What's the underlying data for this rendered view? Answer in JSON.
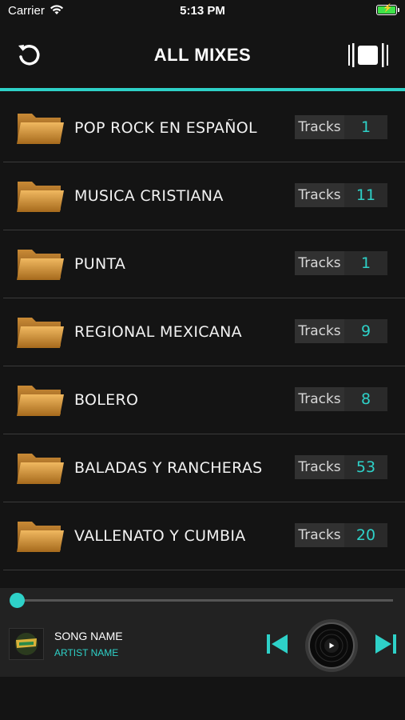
{
  "status_bar": {
    "carrier": "Carrier",
    "time": "5:13 PM"
  },
  "header": {
    "title": "ALL MIXES",
    "accent_color": "#2ed1c8"
  },
  "mixes": [
    {
      "name": "POP ROCK EN ESPAÑOL",
      "tracks_label": "Tracks",
      "count": "1"
    },
    {
      "name": "MUSICA CRISTIANA",
      "tracks_label": "Tracks",
      "count": "11"
    },
    {
      "name": "PUNTA",
      "tracks_label": "Tracks",
      "count": "1"
    },
    {
      "name": "REGIONAL MEXICANA",
      "tracks_label": "Tracks",
      "count": "9"
    },
    {
      "name": "BOLERO",
      "tracks_label": "Tracks",
      "count": "8"
    },
    {
      "name": "BALADAS Y RANCHERAS",
      "tracks_label": "Tracks",
      "count": "53"
    },
    {
      "name": "VALLENATO Y CUMBIA",
      "tracks_label": "Tracks",
      "count": "20"
    }
  ],
  "player": {
    "song_name": "SONG NAME",
    "artist_name": "ARTIST NAME",
    "progress": 0,
    "icons": [
      "previous-icon",
      "play-icon",
      "next-icon"
    ]
  }
}
